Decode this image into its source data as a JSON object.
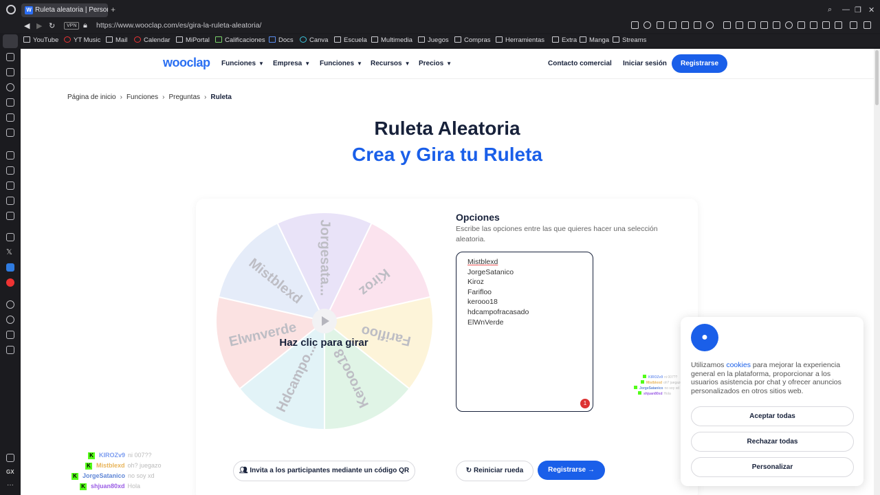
{
  "browser": {
    "tab_title": "Ruleta aleatoria | Persona",
    "tab_favicon": "W",
    "new_tab": "+",
    "vpn": "VPN",
    "url": "https://www.wooclap.com/es/gira-la-ruleta-aleatoria/",
    "bookmarks": [
      "YouTube",
      "YT Music",
      "Mail",
      "Calendar",
      "MiPortal",
      "Calificaciones",
      "Docs",
      "Canva",
      "Escuela",
      "Multimedia",
      "Juegos",
      "Compras",
      "Herramientas",
      "Extra",
      "Manga",
      "Streams"
    ],
    "sidebar_gx": "GX"
  },
  "header": {
    "brand": "wooclap",
    "menus": [
      "Funciones",
      "Empresa",
      "Funciones",
      "Recursos",
      "Precios"
    ],
    "contact": "Contacto comercial",
    "login": "Iniciar sesión",
    "register": "Registrarse"
  },
  "breadcrumb": [
    "Página de inicio",
    "Funciones",
    "Preguntas",
    "Ruleta"
  ],
  "title": "Ruleta Aleatoria",
  "subtitle": "Crea y Gira tu Ruleta",
  "wheel": {
    "segments": [
      "Jorgesata...",
      "Kiroz",
      "Farifloo",
      "Kerooo18",
      "Hdcampo...",
      "Elwnverde",
      "Mistblexd"
    ],
    "colors": [
      "#e9e3f8",
      "#fbe3ee",
      "#fdf4d9",
      "#e0f4e6",
      "#e2f3f7",
      "#fbe2e2",
      "#e5ecf9"
    ],
    "spin_label": "Haz clic para girar"
  },
  "options": {
    "title": "Opciones",
    "description": "Escribe las opciones entre las que quieres hacer una selección aleatoria.",
    "lines": [
      "Mistblexd",
      "JorgeSatanico",
      "Kiroz",
      "Farifloo",
      "kerooo18",
      "hdcampofracasado",
      "ElWnVerde"
    ],
    "badge": "1"
  },
  "actions": {
    "qr": "Invita a los participantes mediante un código QR",
    "reset": "Reiniciar rueda",
    "register": "Registrarse"
  },
  "cookie": {
    "text_before": "Utilizamos ",
    "link": "cookies",
    "text_after": " para mejorar la experiencia general en la plataforma, proporcionar a los usuarios asistencia por chat y ofrecer anuncios personalizados en otros sitios web.",
    "accept": "Aceptar todas",
    "reject": "Rechazar todas",
    "customize": "Personalizar"
  },
  "chat": [
    {
      "user": "KIROZv9",
      "msg": "ni 007??",
      "color": "#7b9cf0"
    },
    {
      "user": "Mistblexd",
      "msg": "oh? juegazo",
      "color": "#e8b45a"
    },
    {
      "user": "JorgeSatanico",
      "msg": "no soy xd",
      "color": "#5f86d6"
    },
    {
      "user": "shjuan80xd",
      "msg": "Hola",
      "color": "#9b5de5"
    }
  ]
}
